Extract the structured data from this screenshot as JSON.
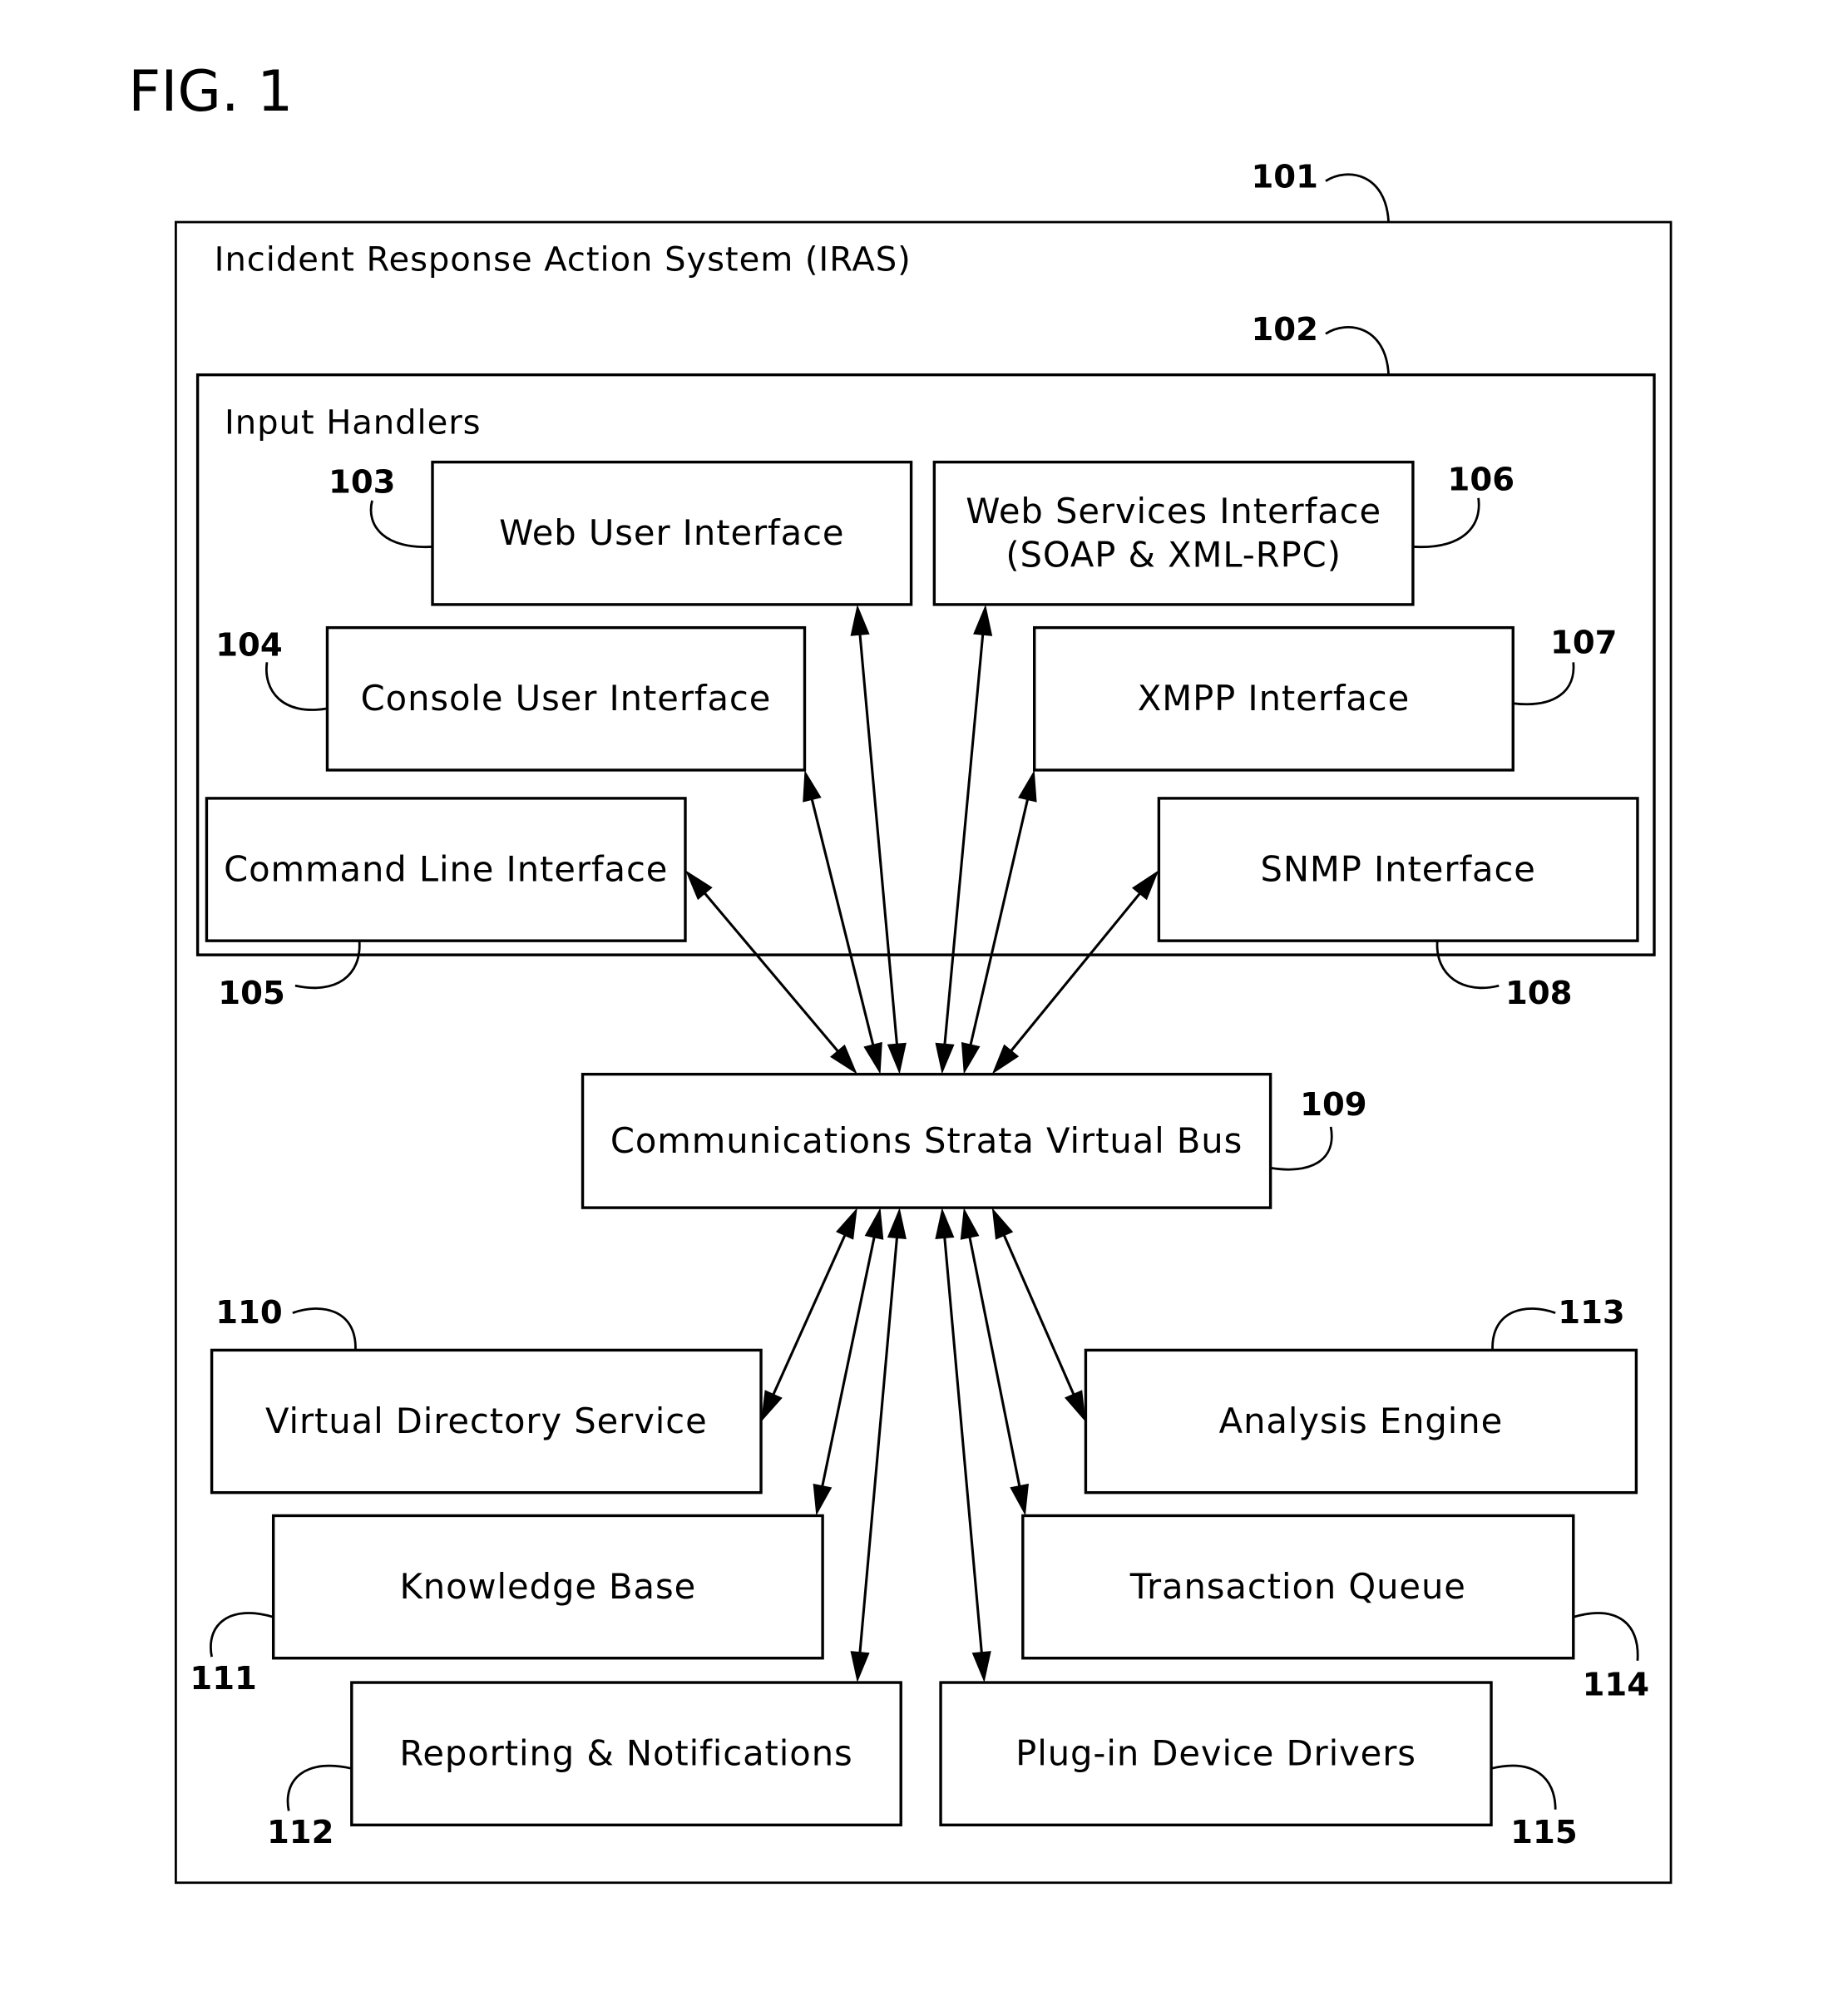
{
  "figure": {
    "title": "FIG. 1"
  },
  "system": {
    "ref": "101",
    "title": "Incident Response Action System (IRAS)"
  },
  "input_handlers": {
    "ref": "102",
    "title": "Input Handlers"
  },
  "components": {
    "web_ui": {
      "ref": "103",
      "lines": [
        "Web User Interface"
      ]
    },
    "console_ui": {
      "ref": "104",
      "lines": [
        "Console User Interface"
      ]
    },
    "cli": {
      "ref": "105",
      "lines": [
        "Command Line Interface"
      ]
    },
    "web_services": {
      "ref": "106",
      "lines": [
        "Web Services Interface",
        "(SOAP & XML-RPC)"
      ]
    },
    "xmpp": {
      "ref": "107",
      "lines": [
        "XMPP Interface"
      ]
    },
    "snmp": {
      "ref": "108",
      "lines": [
        "SNMP Interface"
      ]
    },
    "bus": {
      "ref": "109",
      "lines": [
        "Communications Strata Virtual Bus"
      ]
    },
    "vds": {
      "ref": "110",
      "lines": [
        "Virtual Directory Service"
      ]
    },
    "kb": {
      "ref": "111",
      "lines": [
        "Knowledge Base"
      ]
    },
    "reporting": {
      "ref": "112",
      "lines": [
        "Reporting & Notifications"
      ]
    },
    "analysis": {
      "ref": "113",
      "lines": [
        "Analysis Engine"
      ]
    },
    "tq": {
      "ref": "114",
      "lines": [
        "Transaction Queue"
      ]
    },
    "plugins": {
      "ref": "115",
      "lines": [
        "Plug-in Device Drivers"
      ]
    }
  },
  "connections": [
    {
      "from": "bus",
      "to": "cli",
      "bidirectional": true
    },
    {
      "from": "bus",
      "to": "console_ui",
      "bidirectional": true
    },
    {
      "from": "bus",
      "to": "web_ui",
      "bidirectional": true
    },
    {
      "from": "bus",
      "to": "web_services",
      "bidirectional": true
    },
    {
      "from": "bus",
      "to": "xmpp",
      "bidirectional": true
    },
    {
      "from": "bus",
      "to": "snmp",
      "bidirectional": true
    },
    {
      "from": "bus",
      "to": "vds",
      "bidirectional": true
    },
    {
      "from": "bus",
      "to": "kb",
      "bidirectional": true
    },
    {
      "from": "bus",
      "to": "reporting",
      "bidirectional": true
    },
    {
      "from": "bus",
      "to": "plugins",
      "bidirectional": true
    },
    {
      "from": "bus",
      "to": "tq",
      "bidirectional": true
    },
    {
      "from": "bus",
      "to": "analysis",
      "bidirectional": true
    }
  ]
}
